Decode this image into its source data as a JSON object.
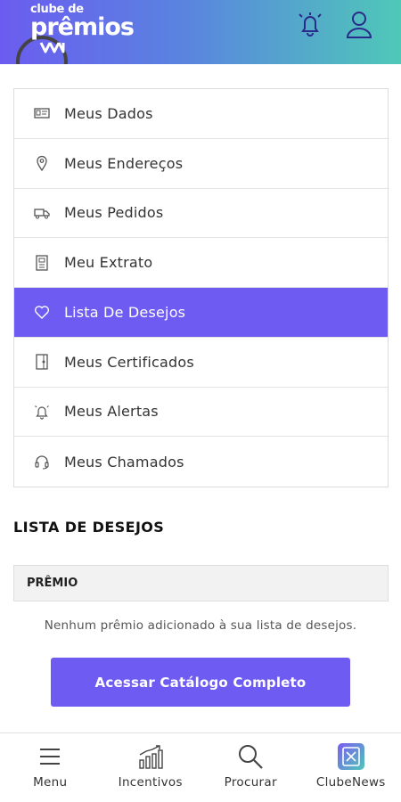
{
  "header": {
    "logo_line1": "clube de",
    "logo_line2": "prêmios",
    "colors": {
      "gradient_start": "#6b5cf0",
      "gradient_end": "#4fc8b8"
    },
    "icons": [
      "bell-icon",
      "user-icon"
    ]
  },
  "menu": {
    "items": [
      {
        "label": "Meus Dados",
        "icon": "id-card-icon"
      },
      {
        "label": "Meus Endereços",
        "icon": "location-pin-icon"
      },
      {
        "label": "Meus Pedidos",
        "icon": "truck-icon"
      },
      {
        "label": "Meu Extrato",
        "icon": "statement-icon"
      },
      {
        "label": "Lista De Desejos",
        "icon": "heart-icon",
        "active": true
      },
      {
        "label": "Meus Certificados",
        "icon": "certificate-icon"
      },
      {
        "label": "Meus Alertas",
        "icon": "bell-icon"
      },
      {
        "label": "Meus Chamados",
        "icon": "headset-icon"
      }
    ],
    "active_color": "#6e5cf2"
  },
  "wishlist": {
    "title": "LISTA DE DESEJOS",
    "column_header": "PRÊMIO",
    "empty_message": "Nenhum prêmio adicionado à sua lista de desejos.",
    "cta_label": "Acessar Catálogo Completo"
  },
  "bottom_nav": {
    "items": [
      {
        "label": "Menu",
        "icon": "hamburger-menu-icon"
      },
      {
        "label": "Incentivos",
        "icon": "bar-chart-icon"
      },
      {
        "label": "Procurar",
        "icon": "search-icon"
      },
      {
        "label": "ClubeNews",
        "icon": "clubenews-icon"
      }
    ]
  }
}
